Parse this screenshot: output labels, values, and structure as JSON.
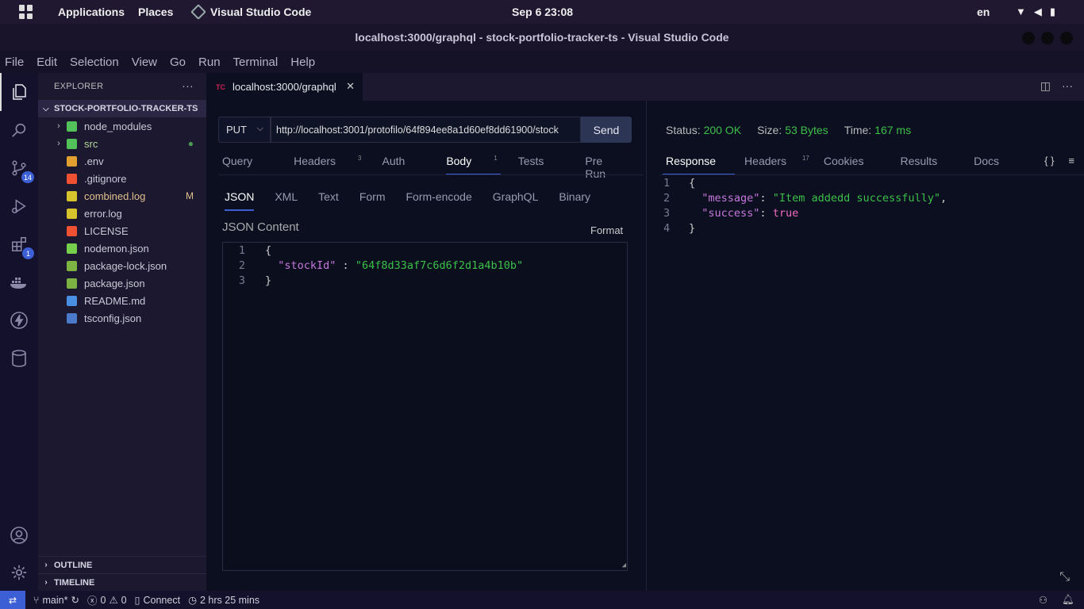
{
  "topbar": {
    "applications": "Applications",
    "places": "Places",
    "active_app": "Visual Studio Code",
    "clock": "Sep 6  23:08",
    "lang": "en"
  },
  "window": {
    "title": "localhost:3000/graphql - stock-portfolio-tracker-ts - Visual Studio Code"
  },
  "menu": [
    "File",
    "Edit",
    "Selection",
    "View",
    "Go",
    "Run",
    "Terminal",
    "Help"
  ],
  "activity": {
    "scm_badge": "14",
    "extensions_badge": "1"
  },
  "explorer": {
    "title": "EXPLORER",
    "project": "STOCK-PORTFOLIO-TRACKER-TS",
    "files": [
      {
        "name": "node_modules",
        "icon": "folder-icon",
        "color": "#53c15a",
        "expandable": true
      },
      {
        "name": "src",
        "icon": "folder-icon",
        "color": "#53c15a",
        "expandable": true,
        "mark": "●"
      },
      {
        "name": ".env",
        "icon": "settings-file-icon",
        "color": "#e2a030"
      },
      {
        "name": ".gitignore",
        "icon": "git-icon",
        "color": "#f05133"
      },
      {
        "name": "combined.log",
        "icon": "log-icon",
        "color": "#d7c32c",
        "mark": "M"
      },
      {
        "name": "error.log",
        "icon": "log-icon",
        "color": "#d7c32c"
      },
      {
        "name": "LICENSE",
        "icon": "license-icon",
        "color": "#f05133"
      },
      {
        "name": "nodemon.json",
        "icon": "nodemon-icon",
        "color": "#76d04b"
      },
      {
        "name": "package-lock.json",
        "icon": "npm-icon",
        "color": "#7cb342"
      },
      {
        "name": "package.json",
        "icon": "npm-icon",
        "color": "#7cb342"
      },
      {
        "name": "README.md",
        "icon": "info-icon",
        "color": "#4a90e2"
      },
      {
        "name": "tsconfig.json",
        "icon": "ts-icon",
        "color": "#4a7ac9"
      }
    ],
    "outline": "OUTLINE",
    "timeline": "TIMELINE"
  },
  "tab": {
    "badge": "TC",
    "label": "localhost:3000/graphql"
  },
  "request": {
    "method": "PUT",
    "url": "http://localhost:3001/protofilo/64f894ee8a1d60ef8dd61900/stock",
    "send": "Send",
    "tabs": [
      {
        "label": "Query",
        "count": ""
      },
      {
        "label": "Headers",
        "count": "3"
      },
      {
        "label": "Auth",
        "count": ""
      },
      {
        "label": "Body",
        "count": "1"
      },
      {
        "label": "Tests",
        "count": ""
      },
      {
        "label": "Pre Run",
        "count": ""
      }
    ],
    "body_tabs": [
      "JSON",
      "XML",
      "Text",
      "Form",
      "Form-encode",
      "GraphQL",
      "Binary"
    ],
    "content_label": "JSON Content",
    "format": "Format",
    "code": [
      {
        "n": "1",
        "text": "{"
      },
      {
        "n": "2",
        "key": "\"stockId\"",
        "sep": " : ",
        "val": "\"64f8d33af7c6d6f2d1a4b10b\""
      },
      {
        "n": "3",
        "text": "}"
      }
    ]
  },
  "response": {
    "status_label": "Status:",
    "status": "200 OK",
    "size_label": "Size:",
    "size": "53 Bytes",
    "time_label": "Time:",
    "time": "167 ms",
    "tabs": [
      {
        "label": "Response",
        "count": ""
      },
      {
        "label": "Headers",
        "count": "17"
      },
      {
        "label": "Cookies",
        "count": ""
      },
      {
        "label": "Results",
        "count": ""
      },
      {
        "label": "Docs",
        "count": ""
      }
    ],
    "braces_icon": "{ }",
    "code": [
      {
        "n": "1",
        "text": "{"
      },
      {
        "n": "2",
        "key": "\"message\"",
        "sep": ": ",
        "val": "\"Item addedd successfully\"",
        "tail": ","
      },
      {
        "n": "3",
        "key": "\"success\"",
        "sep": ": ",
        "bool": "true"
      },
      {
        "n": "4",
        "text": "}"
      }
    ]
  },
  "statusbar": {
    "branch": "main*",
    "errors": "0",
    "warnings": "0",
    "connect": "Connect",
    "timer": "2 hrs 25 mins"
  }
}
